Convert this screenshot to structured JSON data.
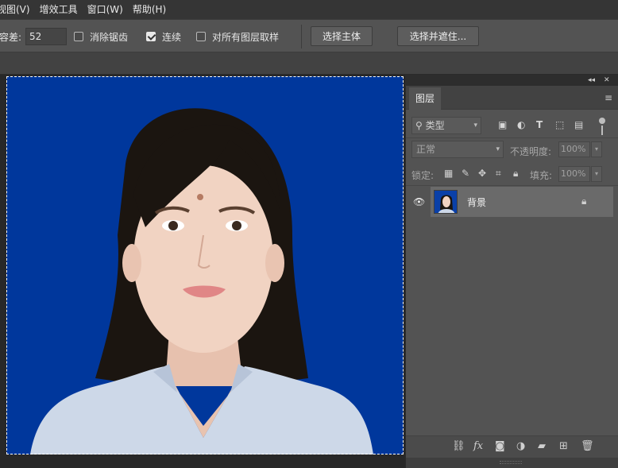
{
  "menu": [
    {
      "label": "视图(V)"
    },
    {
      "label": "增效工具"
    },
    {
      "label": "窗口(W)"
    },
    {
      "label": "帮助(H)"
    }
  ],
  "options": {
    "tolerance_label": "容差:",
    "tolerance_value": "52",
    "anti_alias": {
      "label": "消除锯齿",
      "checked": false
    },
    "contiguous": {
      "label": "连续",
      "checked": true
    },
    "sample_all_layers": {
      "label": "对所有图层取样",
      "checked": false
    },
    "select_subject_label": "选择主体",
    "select_and_mask_label": "选择并遮住..."
  },
  "panel": {
    "tab_label": "图层",
    "filter": {
      "placeholder": "类型",
      "icons": [
        "image-filter-icon",
        "adjustment-filter-icon",
        "text-filter-icon",
        "shape-filter-icon",
        "smart-object-filter-icon"
      ]
    },
    "blend_mode": "正常",
    "opacity_label": "不透明度:",
    "opacity_value": "100%",
    "lock_label": "锁定:",
    "fill_label": "填充:",
    "fill_value": "100%",
    "layers": [
      {
        "name": "背景",
        "visible": true,
        "locked": true
      }
    ],
    "bottom_icons": [
      "link-icon",
      "fx-icon",
      "mask-icon",
      "adjustment-icon",
      "folder-icon",
      "new-layer-icon",
      "trash-icon"
    ]
  },
  "colors": {
    "background_blue": "#00379c",
    "menubar": "#353535",
    "options_bar": "#535353",
    "panel": "#535353",
    "selected_layer": "#6a6a6a"
  }
}
